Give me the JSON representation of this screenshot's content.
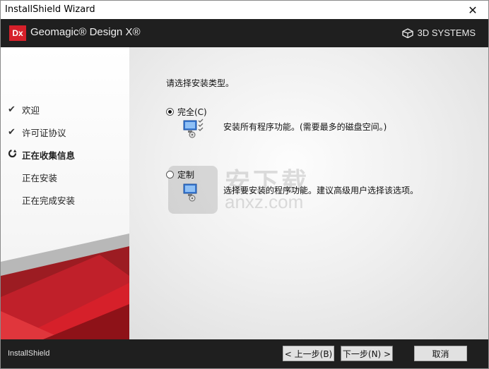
{
  "window": {
    "title": "InstallShield Wizard",
    "close_glyph": "✕"
  },
  "banner": {
    "logo_text": "Dx",
    "product": "Geomagic® Design X®",
    "company": "3D SYSTEMS"
  },
  "sidebar": {
    "steps": [
      {
        "label": "欢迎",
        "status": "done"
      },
      {
        "label": "许可证协议",
        "status": "done"
      },
      {
        "label": "正在收集信息",
        "status": "current"
      },
      {
        "label": "正在安装",
        "status": "pending"
      },
      {
        "label": "正在完成安装",
        "status": "pending"
      }
    ]
  },
  "main": {
    "prompt": "请选择安装类型。",
    "options": [
      {
        "label": "完全(C)",
        "selected": true,
        "description": "安装所有程序功能。(需要最多的磁盘空间。)"
      },
      {
        "label": "定制",
        "selected": false,
        "description": "选择要安装的程序功能。建议高级用户选择该选项。"
      }
    ],
    "watermark": {
      "cn": "安下载",
      "en": "anxz.com"
    }
  },
  "footer": {
    "brand": "InstallShield",
    "back_label": "< 上一步(B)",
    "next_label": "下一步(N) >",
    "cancel_label": "取消"
  },
  "colors": {
    "accent_red": "#d6202a",
    "banner_bg": "#1f1f1f"
  }
}
